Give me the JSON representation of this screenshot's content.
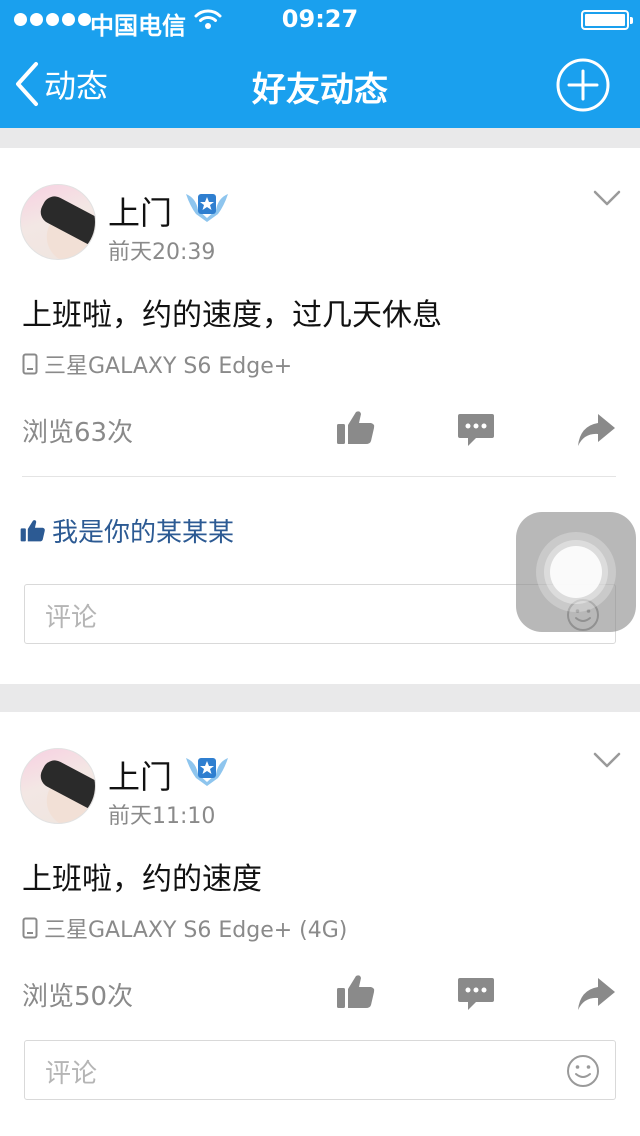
{
  "status_bar": {
    "carrier": "中国电信",
    "time": "09:27",
    "battery_level": 1.0
  },
  "nav": {
    "back_label": "动态",
    "title": "好友动态",
    "add_icon": "plus-circle-icon"
  },
  "posts": [
    {
      "user": "上门",
      "time": "前天20:39",
      "content": "上班啦，约的速度，过几天休息",
      "device": "三星GALAXY S6 Edge+",
      "views": "浏览63次",
      "likes": "我是你的某某某",
      "comment_placeholder": "评论"
    },
    {
      "user": "上门",
      "time": "前天11:10",
      "content": "上班啦，约的速度",
      "device": "三星GALAXY S6 Edge+ (4G)",
      "views": "浏览50次",
      "comment_placeholder": "评论"
    }
  ],
  "colors": {
    "header": "#1aa0ee",
    "action_icon": "#8a8a8a",
    "like_link": "#2c5a93"
  }
}
